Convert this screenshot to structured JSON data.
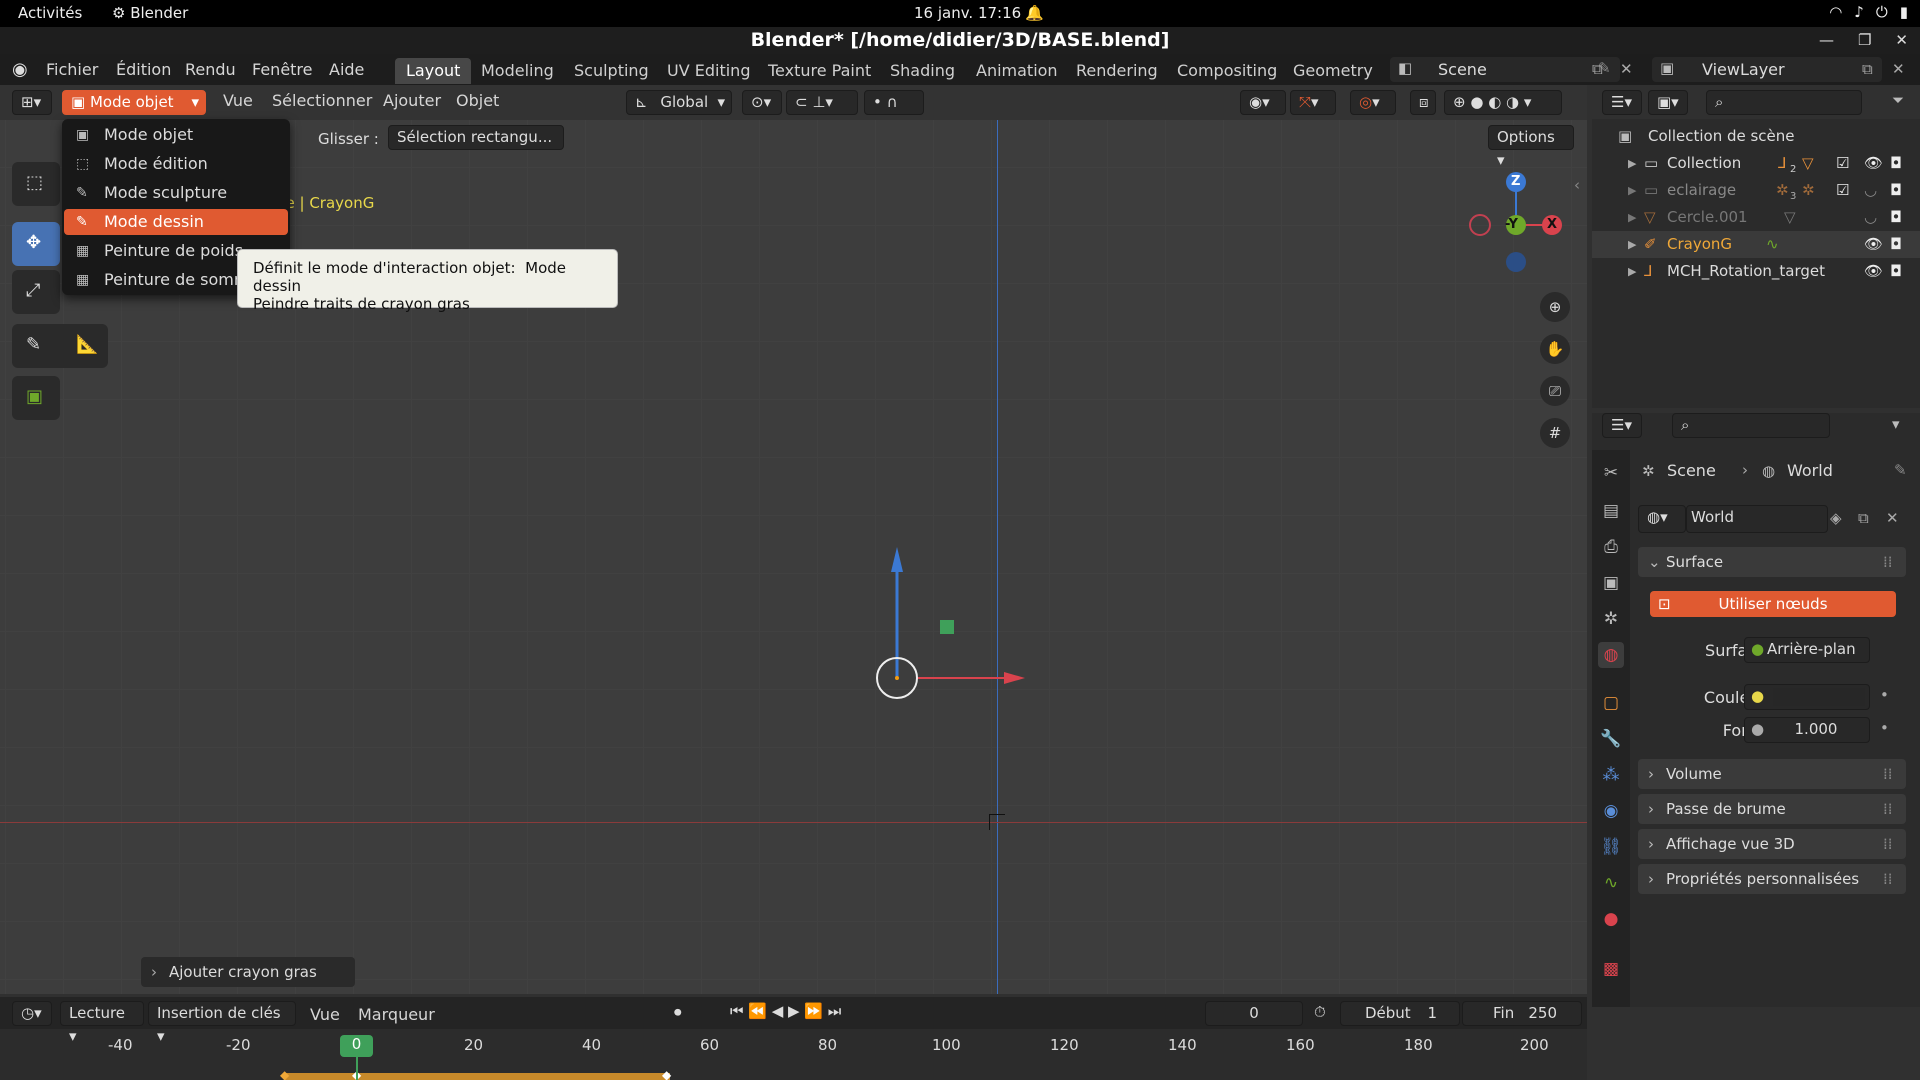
{
  "gnome": {
    "activities": "Activités",
    "app": "Blender",
    "clock": "16 janv.  17:16"
  },
  "window": {
    "title": "Blender* [/home/didier/3D/BASE.blend]"
  },
  "menubar": {
    "items": [
      "Fichier",
      "Édition",
      "Rendu",
      "Fenêtre",
      "Aide"
    ]
  },
  "workspaces": {
    "tabs": [
      "Layout",
      "Modeling",
      "Sculpting",
      "UV Editing",
      "Texture Paint",
      "Shading",
      "Animation",
      "Rendering",
      "Compositing",
      "Geometry N"
    ],
    "active": "Layout"
  },
  "scene": {
    "label": "Scene"
  },
  "viewlayer": {
    "label": "ViewLayer"
  },
  "viewport_header": {
    "mode": "Mode objet",
    "menus": [
      "Vue",
      "Sélectionner",
      "Ajouter",
      "Objet"
    ],
    "orientation": "Global",
    "glisser_label": "Glisser :",
    "glisser_value": "Sélection rectangu...",
    "options": "Options"
  },
  "viewport_info": {
    "object": "ne | CrayonG"
  },
  "dropdown": {
    "items": [
      "Mode objet",
      "Mode édition",
      "Mode sculpture",
      "Mode dessin",
      "Peinture de poids",
      "Peinture de somm"
    ],
    "highlighted": "Mode dessin"
  },
  "tooltip": {
    "line1_label": "Définit le mode d'interaction objet:",
    "line1_value": "Mode dessin",
    "line2": "Peindre traits de crayon gras"
  },
  "gizmo": {
    "z": "Z",
    "y": "-Y",
    "x": "X"
  },
  "operator_panel": {
    "label": "Ajouter crayon gras"
  },
  "outliner": {
    "root": "Collection de scène",
    "rows": [
      {
        "name": "Collection",
        "count": "2"
      },
      {
        "name": "eclairage",
        "count": "3"
      },
      {
        "name": "Cercle.001",
        "count": ""
      },
      {
        "name": "CrayonG",
        "count": ""
      },
      {
        "name": "MCH_Rotation_target",
        "count": ""
      }
    ]
  },
  "properties": {
    "breadcrumb_scene": "Scene",
    "breadcrumb_world": "World",
    "world_name": "World",
    "surface_panel": "Surface",
    "use_nodes": "Utiliser nœuds",
    "surface_label": "Surface",
    "surface_value": "Arrière-plan",
    "color_label": "Couleur",
    "force_label": "Force",
    "force_value": "1.000",
    "panels": [
      "Volume",
      "Passe de brume",
      "Affichage vue 3D",
      "Propriétés personnalisées"
    ]
  },
  "timeline": {
    "menus": [
      "Lecture",
      "Insertion de clés",
      "Vue",
      "Marqueur"
    ],
    "current_frame": "0",
    "start_label": "Début",
    "start_value": "1",
    "end_label": "Fin",
    "end_value": "250",
    "ticks": [
      "-40",
      "-20",
      "0",
      "20",
      "40",
      "60",
      "80",
      "100",
      "120",
      "140",
      "160",
      "180",
      "200"
    ]
  },
  "colors": {
    "accent_orange": "#e05a31",
    "selection_blue": "#4772b3",
    "axis_red": "#d9434d",
    "axis_green": "#6fa82a",
    "axis_blue": "#3b79d4"
  }
}
